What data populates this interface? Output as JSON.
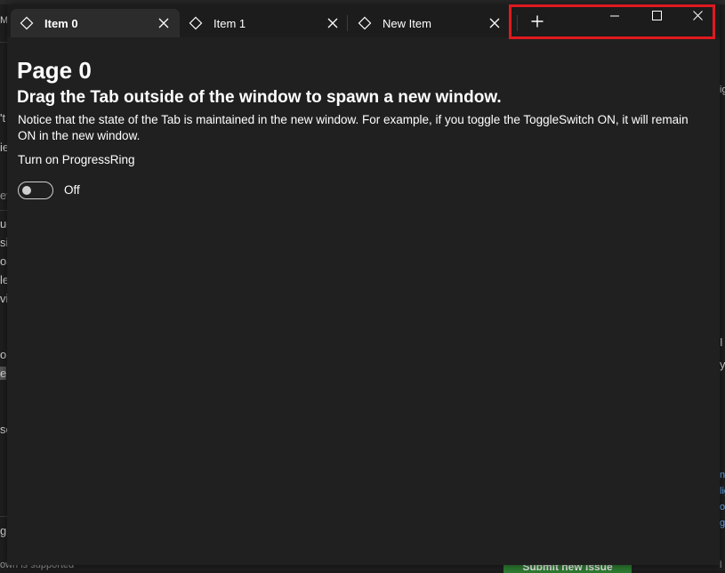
{
  "background_window": {
    "fragments": [
      "M",
      "'t",
      "ie",
      "ev",
      "uc",
      "si",
      "oa",
      "le",
      "vi",
      "o",
      "e",
      "se",
      "g",
      "own is supported"
    ],
    "right_fragments": [
      "ig",
      "I",
      "y",
      "ng",
      "lig",
      "oli",
      "g",
      "l"
    ],
    "submit_label": "Submit new issue"
  },
  "tabs": [
    {
      "label": "Item 0",
      "icon": "diamond-icon",
      "active": true
    },
    {
      "label": "Item 1",
      "icon": "diamond-icon",
      "active": false
    },
    {
      "label": "New Item",
      "icon": "diamond-icon",
      "active": false
    }
  ],
  "caption_buttons": {
    "add_tab": "+",
    "minimize": "minimize-icon",
    "maximize": "maximize-icon",
    "close": "close-icon"
  },
  "colors": {
    "highlight": "#e0191f",
    "window_bg": "#202020",
    "tab_active": "#2c2c2c"
  },
  "content": {
    "title": "Page 0",
    "subtitle": "Drag the Tab outside of the window to spawn a new window.",
    "description": "Notice that the state of the Tab is maintained in the new window. For example, if you toggle the ToggleSwitch ON, it will remain ON in the new window.",
    "toggle_header": "Turn on ProgressRing",
    "toggle_state": "Off",
    "toggle_on": false
  }
}
